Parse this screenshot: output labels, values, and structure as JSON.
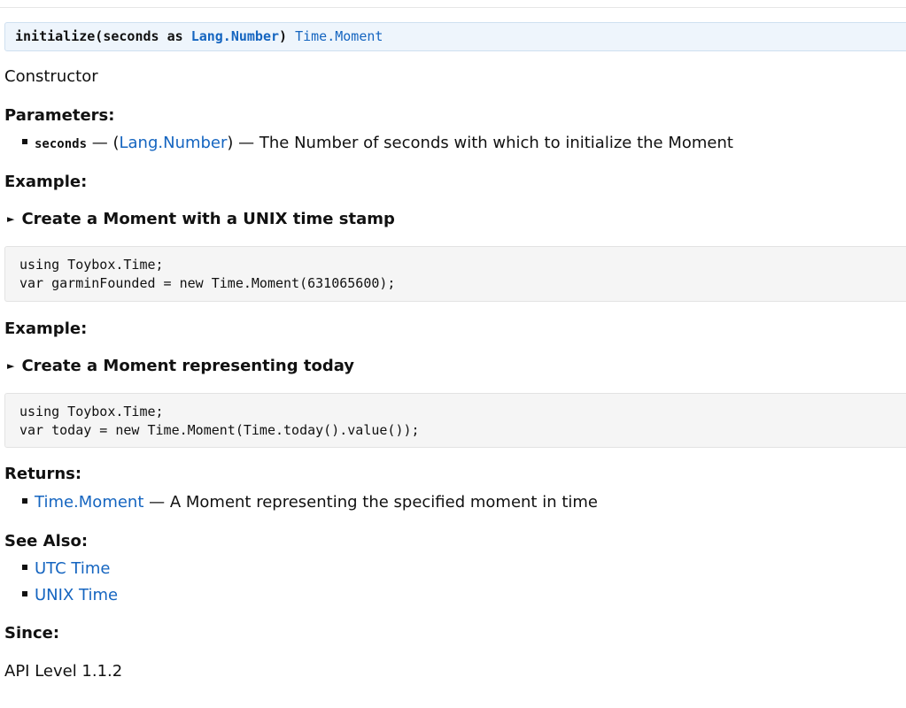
{
  "signature": {
    "prefix": "initialize(seconds as ",
    "param_type": "Lang.Number",
    "suffix": ")",
    "return_type": "Time.Moment"
  },
  "description": "Constructor",
  "parameters": {
    "heading": "Parameters:",
    "items": [
      {
        "name": "seconds",
        "dash1": " — (",
        "type": "Lang.Number",
        "desc": ") — The Number of seconds with which to initialize the Moment"
      }
    ]
  },
  "examples": [
    {
      "heading": "Example:",
      "summary": "Create a Moment with a UNIX time stamp",
      "code": "using Toybox.Time;\nvar garminFounded = new Time.Moment(631065600);"
    },
    {
      "heading": "Example:",
      "summary": "Create a Moment representing today",
      "code": "using Toybox.Time;\nvar today = new Time.Moment(Time.today().value());"
    }
  ],
  "returns": {
    "heading": "Returns:",
    "type": "Time.Moment",
    "desc": " — A Moment representing the specified moment in time"
  },
  "see_also": {
    "heading": "See Also:",
    "links": [
      "UTC Time",
      "UNIX Time"
    ]
  },
  "since": {
    "heading": "Since:",
    "value": "API Level 1.1.2"
  }
}
